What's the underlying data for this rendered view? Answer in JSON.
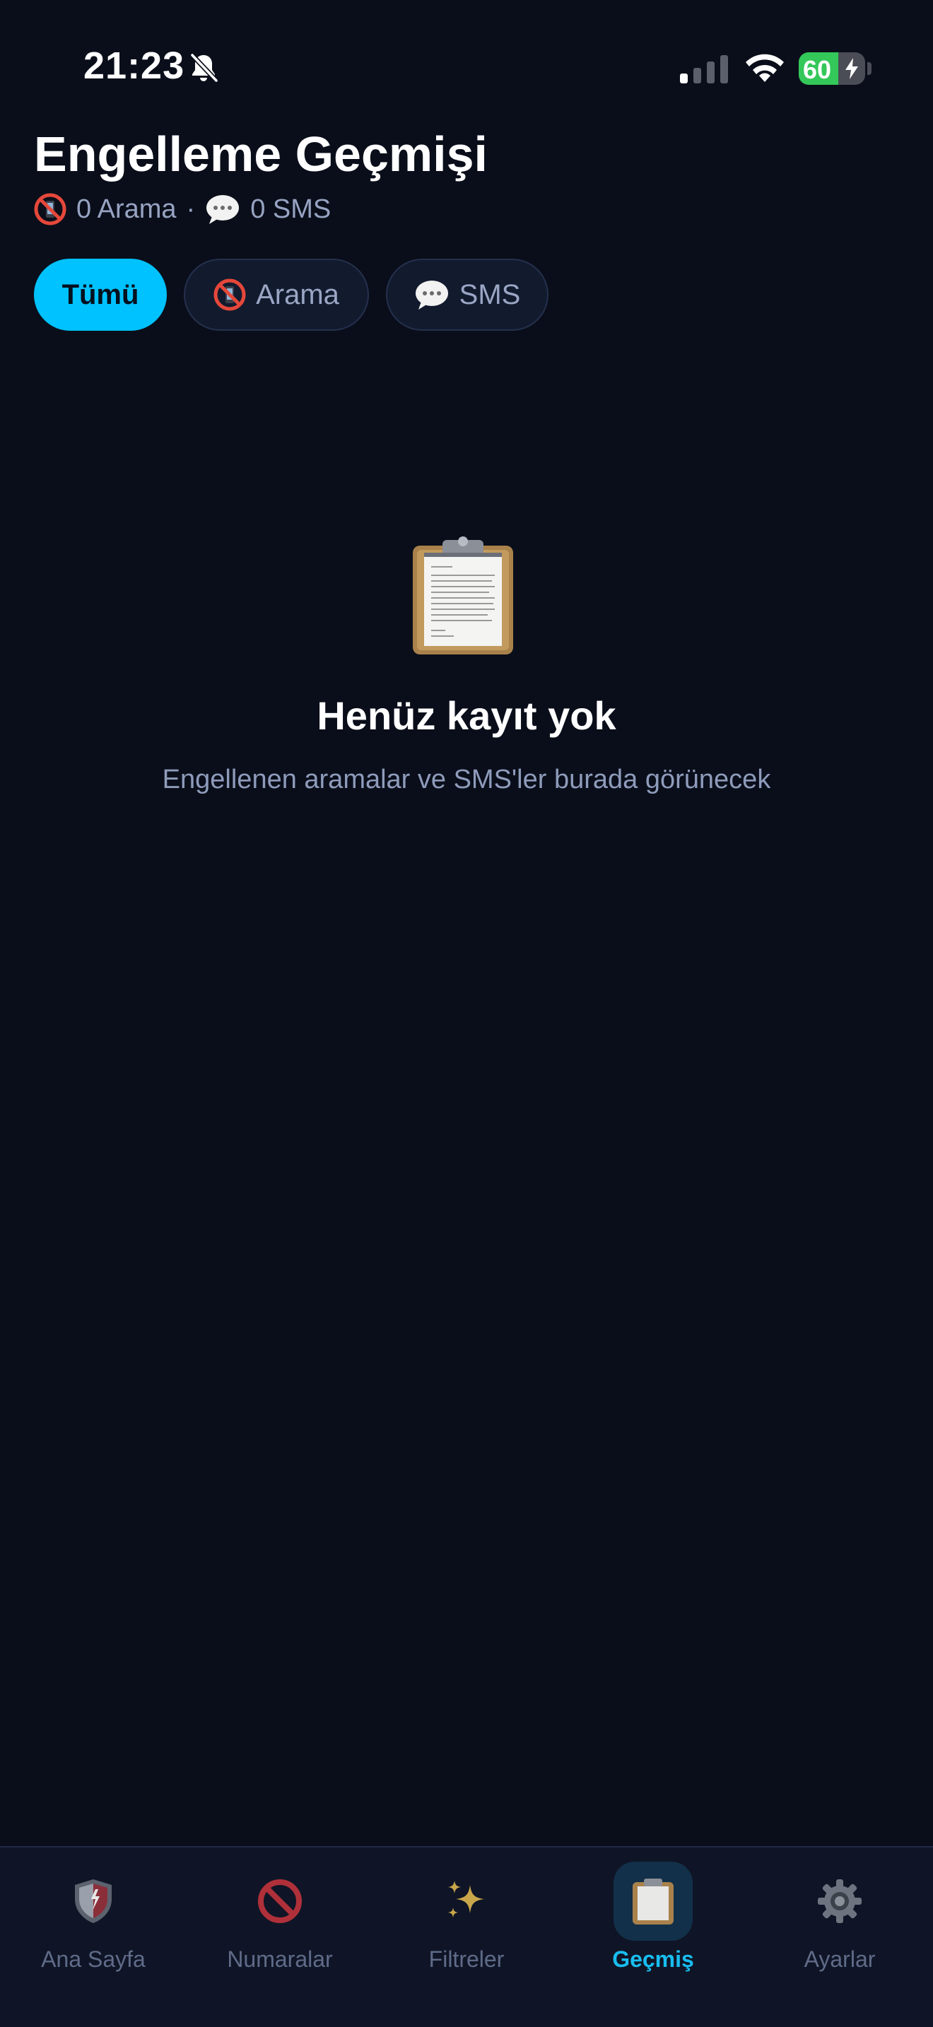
{
  "status_bar": {
    "time": "21:23",
    "battery_level": "60",
    "battery_percent": 60,
    "icons": [
      "bell-off-icon",
      "cellular-signal-icon",
      "wifi-icon",
      "battery-charging-icon"
    ]
  },
  "header": {
    "title": "Engelleme Geçmişi",
    "call_count_label": "0 Arama",
    "separator": "·",
    "sms_count_label": "0 SMS"
  },
  "filters": {
    "all_label": "Tümü",
    "call_label": "Arama",
    "sms_label": "SMS",
    "selected": "Tümü"
  },
  "empty_state": {
    "icon": "clipboard-icon",
    "title": "Henüz kayıt yok",
    "description": "Engellenen aramalar ve SMS'ler burada görünecek"
  },
  "tab_bar": {
    "items": [
      {
        "label": "Ana Sayfa",
        "icon": "shield-icon",
        "active": false
      },
      {
        "label": "Numaralar",
        "icon": "prohibited-icon",
        "active": false
      },
      {
        "label": "Filtreler",
        "icon": "sparkles-icon",
        "active": false
      },
      {
        "label": "Geçmiş",
        "icon": "clipboard-icon",
        "active": true
      },
      {
        "label": "Ayarlar",
        "icon": "gear-icon",
        "active": false
      }
    ]
  },
  "colors": {
    "background": "#0a0e1a",
    "accent": "#00c2ff",
    "active_tab_text": "#19bdf0",
    "muted_text": "#8e9bbb",
    "battery_green": "#34c759"
  }
}
